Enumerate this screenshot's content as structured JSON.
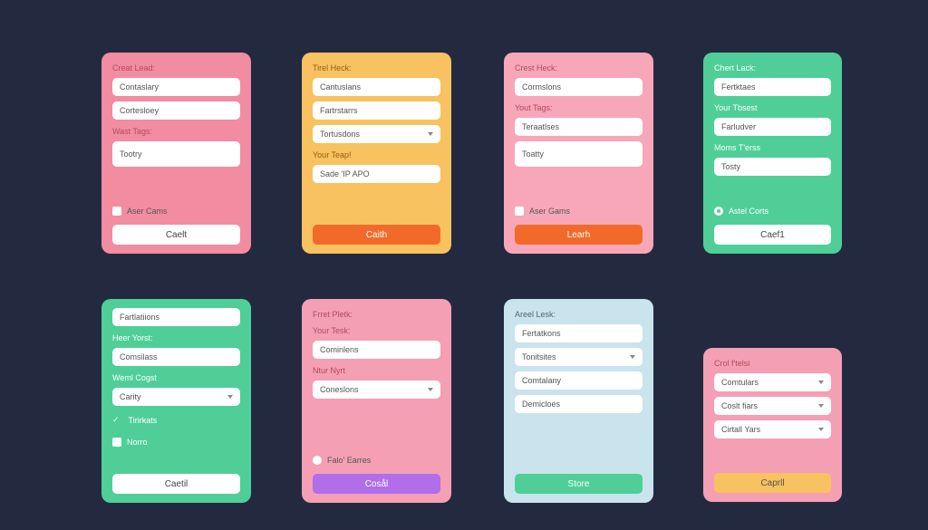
{
  "cards": {
    "c1": {
      "title": "Creat Lead:",
      "f1": "Contaslary",
      "f2": "Cortesloey",
      "l3": "Wast Tags:",
      "f3": "Tootry",
      "chk": "Aser Cams",
      "btn": "Caelt"
    },
    "c2": {
      "title": "Tirel Heck:",
      "f1": "Cantuslans",
      "f2": "Fartrstarrs",
      "f3": "Tortusdons",
      "l4": "Your Teap!",
      "f4": "Sade 'IP APO",
      "btn": "Caith"
    },
    "c3": {
      "title": "Crest Heck:",
      "f1": "Cormslons",
      "l2": "Yout Tags:",
      "f2": "Teraatlses",
      "f3": "Toatty",
      "chk": "Aser Gams",
      "btn": "Learh"
    },
    "c4": {
      "title": "Chert Lack:",
      "f1": "Fertktaes",
      "l2": "Your Tbsest",
      "f2": "Farludver",
      "l3": "Moms T'erss",
      "f3": "Tosty",
      "chk": "Astel Corts",
      "btn": "Caef1"
    },
    "c5": {
      "f1": "Fartlatiions",
      "l2": "Heer Yorst:",
      "f2": "Comsilass",
      "l3": "Weml Cogst",
      "f3": "Carity",
      "chk1": "Tirirkats",
      "chk2": "Norro",
      "btn": "Caetil"
    },
    "c6": {
      "title": "Frret Pletk:",
      "l1": "Your Tesk:",
      "f1": "Cominlens",
      "l2": "Ntur Nyrt",
      "f2": "Coneslons",
      "chk": "Falo' Earres",
      "btn": "Cosål"
    },
    "c7": {
      "title": "Areel Lesk:",
      "f1": "Fertatkons",
      "f2": "Tonitsites",
      "f3": "Comtalany",
      "f4": "Demicloes",
      "btn": "Store"
    },
    "c8": {
      "title": "Crol f'telsi",
      "f1": "Comtulars",
      "f2": "Coslt fiars",
      "f3": "Cirtall Yars",
      "btn": "Caprll"
    }
  }
}
